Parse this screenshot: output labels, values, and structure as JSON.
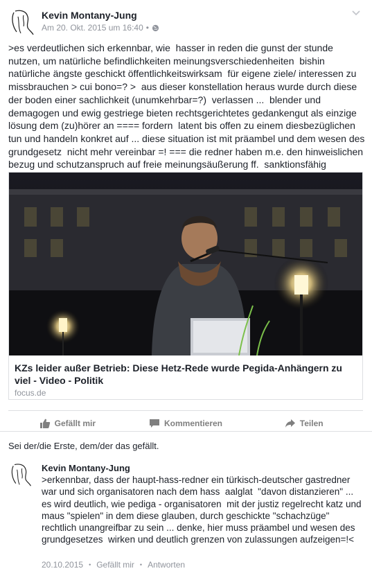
{
  "post": {
    "author": "Kevin Montany-Jung",
    "timestamp": "Am 20. Okt. 2015 um 16:40",
    "meta_separator": "•",
    "audience_icon": "globe-icon",
    "menu_icon": "chevron-down-icon",
    "text": ">es verdeutlichen sich erkennbar, wie  hasser in reden die gunst der stunde nutzen, um natürliche befindlichkeiten meinungsverschiedenheiten  bishin natürliche ängste geschickt öffentlichkeitswirksam  für eigene ziele/ interessen zu missbrauchen > cui bono=? >  aus dieser konstellation heraus wurde durch diese der boden einer sachlichkeit (unumkehrbar=?)  verlassen ...  blender und demagogen und ewig gestriege bieten rechtsgerichtetes gedankengut als einzige lösung dem (zu)hörer an ==== fordern  latent bis offen zu einem diesbezüglichen  tun und handeln konkret auf ... diese situation ist mit präambel und dem wesen des grundgesetz  nicht mehr vereinbar =! === die redner haben m.e. den hinweislichen bezug und schutzanspruch auf freie meinungsäußerung ff.  sanktionsfähig  verwirkt=!<"
  },
  "link_card": {
    "title": "KZs leider außer Betrieb: Diese Hetz-Rede wurde Pegida-Anhängern zu viel - Video - Politik",
    "domain": "focus.de"
  },
  "actions": {
    "like": "Gefällt mir",
    "comment": "Kommentieren",
    "share": "Teilen"
  },
  "likes_summary": "Sei der/die Erste, dem/der das gefällt.",
  "comment": {
    "author": "Kevin Montany-Jung",
    "text": ">erkennbar, dass der haupt-hass-redner ein türkisch-deutscher gastredner war und sich organisatoren nach dem hass  aalglat  \"davon distanzieren\" ... es wird deutlich, wie pediga - organisatoren  mit der justiz regelrecht katz und maus \"spielen\" in dem diese glauben, durch geschickte \"schachzüge\" rechtlich unangreifbar zu sein ... denke, hier muss präambel und wesen des grundgesetzes  wirken und deutlich grenzen von zulassungen aufzeigen=!<",
    "date": "20.10.2015",
    "separator": "•",
    "like": "Gefällt mir",
    "reply": "Antworten"
  },
  "colors": {
    "text": "#1d2129",
    "meta": "#90949c",
    "action": "#7f7f7f",
    "divider": "#dddfe2"
  }
}
